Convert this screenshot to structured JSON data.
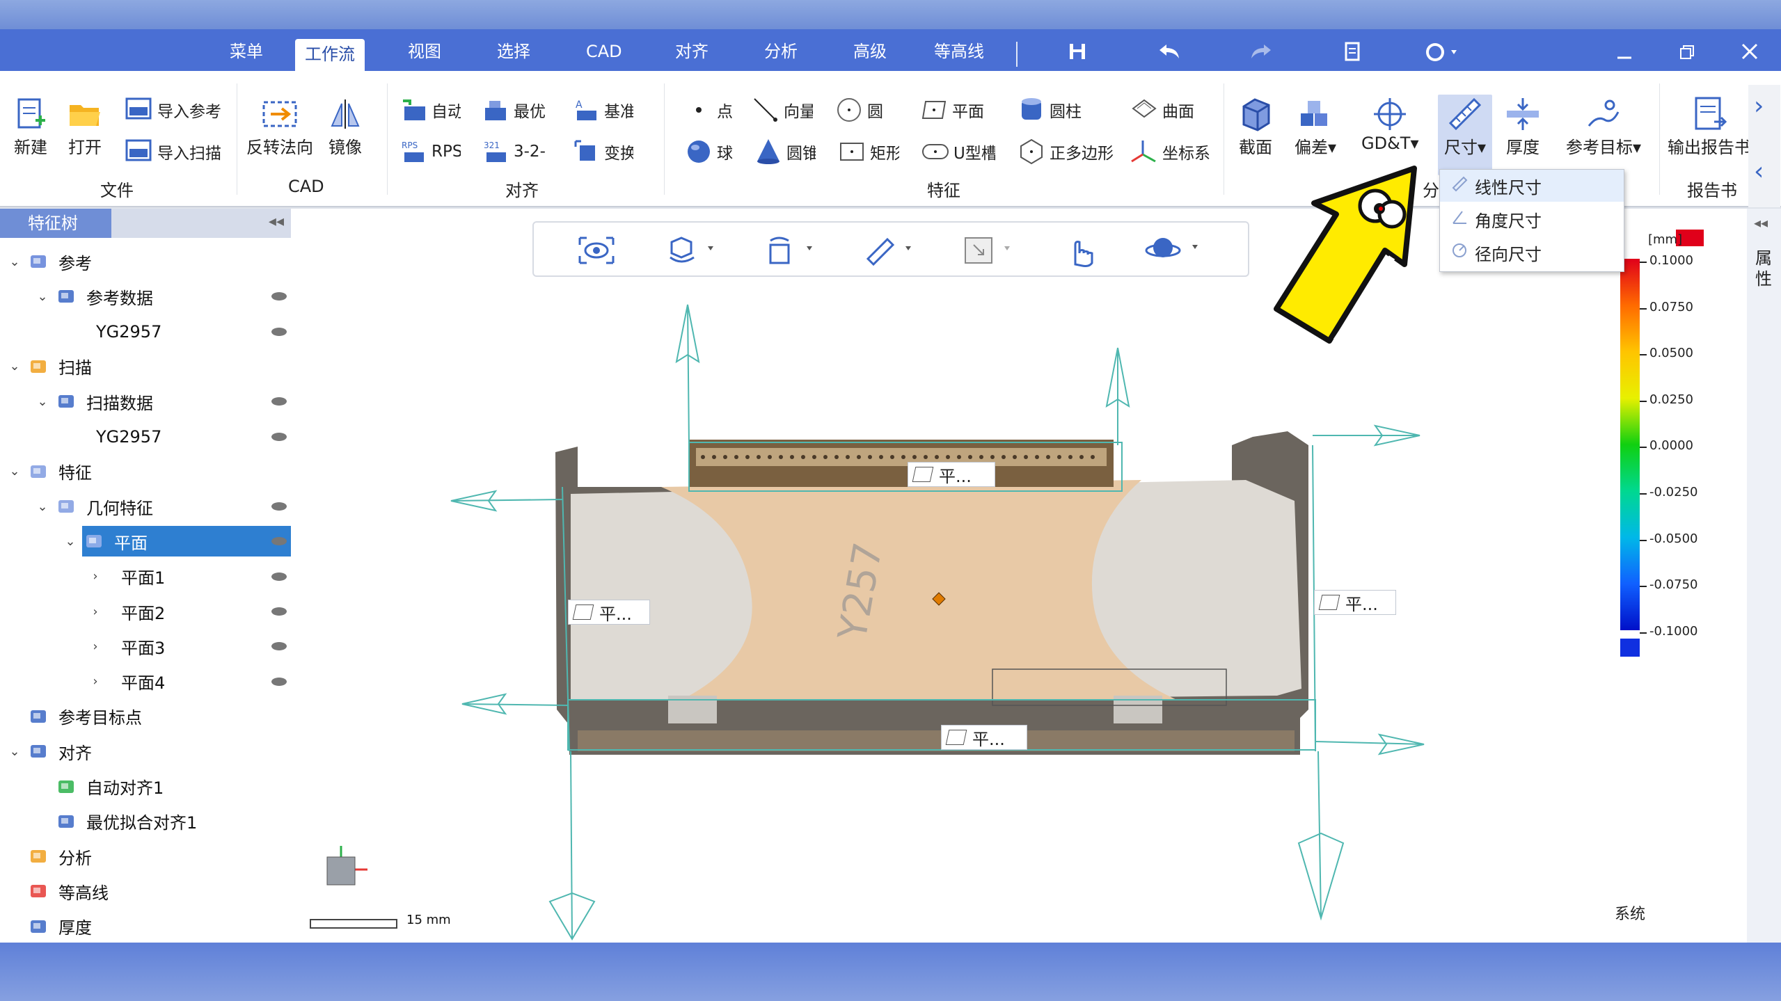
{
  "menubar": {
    "tabs": [
      {
        "label": "菜单",
        "active": false
      },
      {
        "label": "工作流",
        "active": true
      },
      {
        "label": "视图",
        "active": false
      },
      {
        "label": "选择",
        "active": false
      },
      {
        "label": "CAD",
        "active": false
      },
      {
        "label": "对齐",
        "active": false
      },
      {
        "label": "分析",
        "active": false
      },
      {
        "label": "高级",
        "active": false
      },
      {
        "label": "等高线",
        "active": false
      }
    ],
    "quick_icons": [
      "save-icon",
      "undo-icon",
      "redo-icon",
      "report-icon",
      "help-icon"
    ],
    "window_icons": [
      "minimize-icon",
      "restore-icon",
      "close-icon"
    ]
  },
  "ribbon": {
    "file": {
      "new": "新建",
      "open": "打开",
      "import_ref": "导入参考",
      "import_scan": "导入扫描",
      "group": "文件"
    },
    "cad": {
      "reverse_normal": "反转法向",
      "mirror": "镜像",
      "group": "CAD"
    },
    "align": {
      "auto": "自动",
      "rps": "RPS",
      "best": "最优",
      "three_two_one": "3-2-",
      "datum": "基准",
      "transform": "变换",
      "group": "对齐"
    },
    "feature": {
      "point": "点",
      "vector": "向量",
      "circle": "圆",
      "plane": "平面",
      "cylinder": "圆柱",
      "surface": "曲面",
      "sphere": "球",
      "cone": "圆锥",
      "rectangle": "矩形",
      "u_slot": "U型槽",
      "polygon": "正多边形",
      "coordinate": "坐标系",
      "group": "特征"
    },
    "analysis": {
      "section": "截面",
      "deviation": "偏差",
      "gdt": "GD&T",
      "dimension": "尺寸",
      "thickness": "厚度",
      "ref_target": "参考目标",
      "group_partial": "分"
    },
    "report": {
      "output": "输出报告书",
      "group": "报告书"
    }
  },
  "dimension_menu": {
    "items": [
      "线性尺寸",
      "角度尺寸",
      "径向尺寸"
    ],
    "highlighted": 0
  },
  "feature_tree": {
    "tab": "特征树",
    "rows": [
      {
        "label": "参考",
        "level": 0,
        "expanded": true,
        "icon": "reference-icon",
        "eye": false
      },
      {
        "label": "参考数据",
        "level": 1,
        "expanded": true,
        "icon": "document-icon",
        "eye": true
      },
      {
        "label": "YG2957",
        "level": 2,
        "expanded": null,
        "icon": "",
        "eye": true
      },
      {
        "label": "扫描",
        "level": 0,
        "expanded": true,
        "icon": "scan-icon",
        "eye": false
      },
      {
        "label": "扫描数据",
        "level": 1,
        "expanded": true,
        "icon": "document-icon",
        "eye": true
      },
      {
        "label": "YG2957",
        "level": 2,
        "expanded": null,
        "icon": "",
        "eye": true
      },
      {
        "label": "特征",
        "level": 0,
        "expanded": true,
        "icon": "feature-icon",
        "eye": false
      },
      {
        "label": "几何特征",
        "level": 1,
        "expanded": true,
        "icon": "geometry-feature-icon",
        "eye": true
      },
      {
        "label": "平面",
        "level": 2,
        "expanded": true,
        "icon": "plane-icon",
        "eye": true,
        "selected": true
      },
      {
        "label": "平面1",
        "level": 3,
        "expanded": false,
        "icon": "",
        "eye": true
      },
      {
        "label": "平面2",
        "level": 3,
        "expanded": false,
        "icon": "",
        "eye": true
      },
      {
        "label": "平面3",
        "level": 3,
        "expanded": false,
        "icon": "",
        "eye": true
      },
      {
        "label": "平面4",
        "level": 3,
        "expanded": false,
        "icon": "",
        "eye": true
      },
      {
        "label": "参考目标点",
        "level": 0,
        "expanded": null,
        "icon": "target-point-icon",
        "eye": false
      },
      {
        "label": "对齐",
        "level": 0,
        "expanded": true,
        "icon": "align-icon",
        "eye": false
      },
      {
        "label": "自动对齐1",
        "level": 1,
        "expanded": null,
        "icon": "auto-align-icon",
        "eye": false
      },
      {
        "label": "最优拟合对齐1",
        "level": 1,
        "expanded": null,
        "icon": "best-fit-icon",
        "eye": false
      },
      {
        "label": "分析",
        "level": 0,
        "expanded": null,
        "icon": "analysis-icon",
        "eye": false
      },
      {
        "label": "等高线",
        "level": 0,
        "expanded": null,
        "icon": "contour-icon",
        "eye": false
      },
      {
        "label": "厚度",
        "level": 0,
        "expanded": null,
        "icon": "thickness-icon",
        "eye": false
      }
    ]
  },
  "viewport": {
    "plane_labels": [
      "平...",
      "平...",
      "平...",
      "平..."
    ],
    "scale_bar": "15 mm",
    "model_mark": "Y257",
    "toolbar_icons": [
      "view-eye-icon",
      "rotate-view-icon",
      "orient-icon",
      "measure-icon",
      "select-icon",
      "pan-hand-icon",
      "orbit-icon"
    ]
  },
  "color_legend": {
    "unit": "[mm]",
    "values": [
      "0.1000",
      "0.0750",
      "0.0500",
      "0.0250",
      "0.0000",
      "-0.0250",
      "-0.0500",
      "-0.0750",
      "-0.1000"
    ],
    "footer": "系统",
    "colors": [
      "#e0001a",
      "#ff6a00",
      "#ffc400",
      "#e8f000",
      "#10d010",
      "#00d890",
      "#00b8e8",
      "#1060ff",
      "#0010c8"
    ]
  },
  "right_panel": {
    "label": "属性"
  }
}
